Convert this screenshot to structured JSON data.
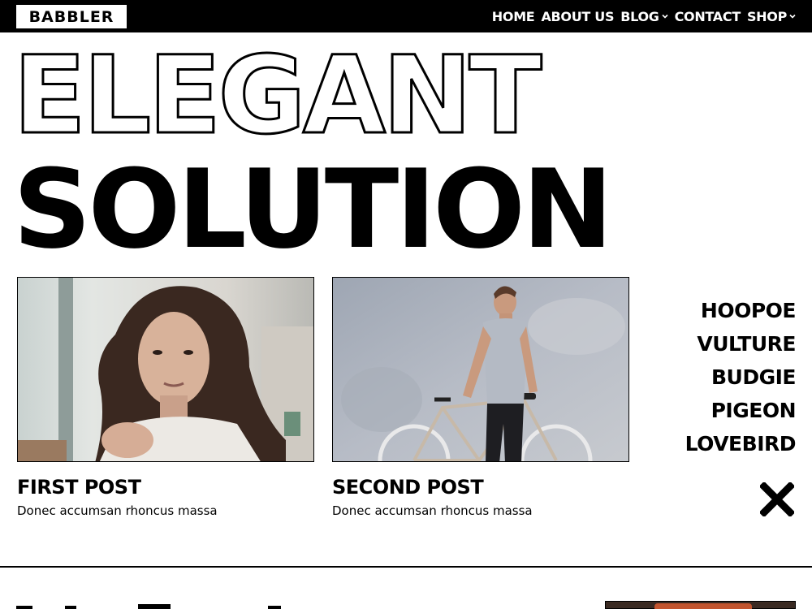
{
  "header": {
    "logo": "BABBLER",
    "nav": [
      {
        "label": "HOME",
        "has_dropdown": false
      },
      {
        "label": "ABOUT US",
        "has_dropdown": false
      },
      {
        "label": "BLOG",
        "has_dropdown": true
      },
      {
        "label": "CONTACT",
        "has_dropdown": false
      },
      {
        "label": "SHOP",
        "has_dropdown": true
      }
    ]
  },
  "hero": {
    "line1": "ELEGANT",
    "line2": "SOLUTION"
  },
  "posts": [
    {
      "title": "FIRST POST",
      "excerpt": "Donec accumsan rhoncus massa"
    },
    {
      "title": "SECOND POST",
      "excerpt": "Donec accumsan rhoncus massa"
    }
  ],
  "side_menu": {
    "items": [
      "HOOPOE",
      "VULTURE",
      "BUDGIE",
      "PIGEON",
      "LOVEBIRD"
    ],
    "close_icon": "close-icon"
  },
  "colors": {
    "bar": "#000000",
    "background": "#ffffff",
    "text": "#000000"
  }
}
